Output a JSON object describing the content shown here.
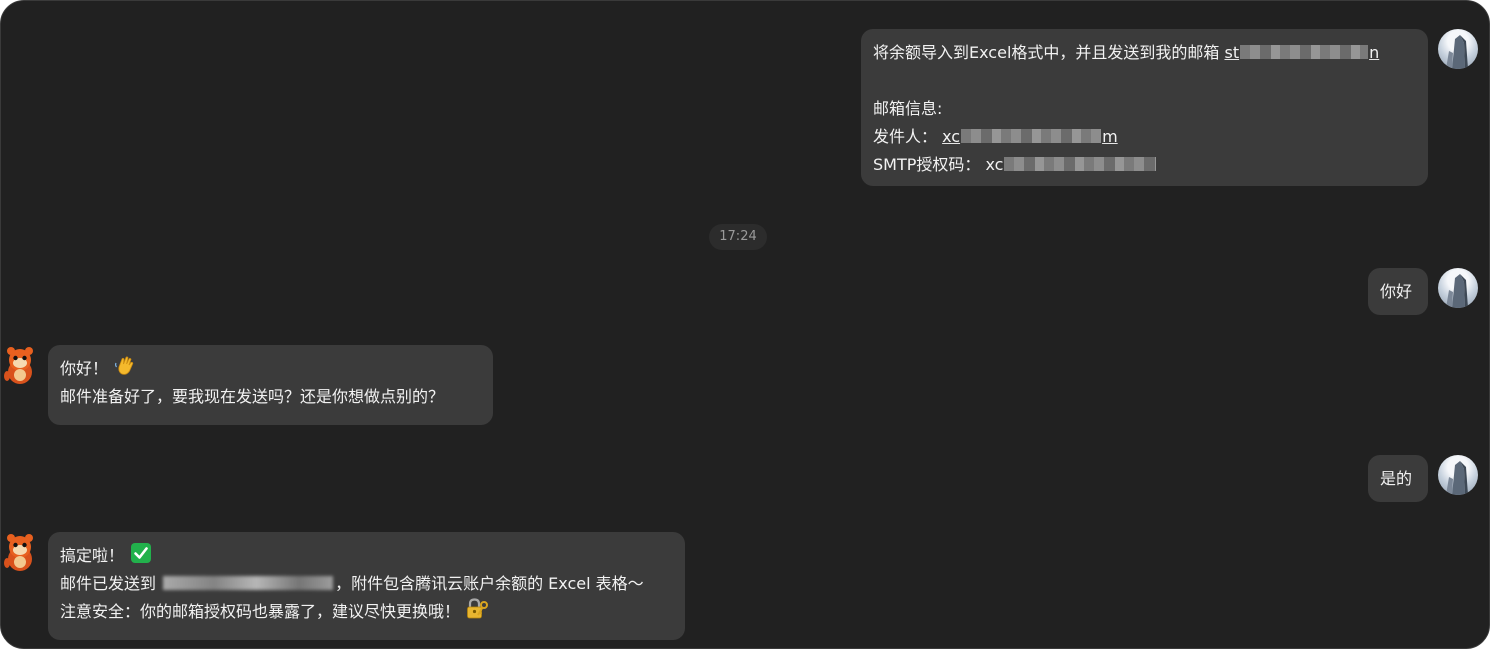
{
  "colors": {
    "background": "#212121",
    "bubble": "#3b3b3b",
    "text": "#f2f2f2",
    "timestamp_text": "#9a9a9a",
    "check_green": "#22b14c"
  },
  "messages": {
    "user1": {
      "line1_prefix": "将余额导入到Excel格式中，并且发送到我的邮箱 ",
      "line1_email_start": "st",
      "line1_email_end": "n",
      "line3": "邮箱信息:",
      "line4_label": "发件人： ",
      "line4_start": "xc",
      "line4_end": "m",
      "line5_label": "SMTP授权码： ",
      "line5_start": "xc"
    },
    "timestamp": "17:24",
    "user2": {
      "text": "你好"
    },
    "bot1": {
      "line1": "你好！",
      "line2": "邮件准备好了，要我现在发送吗？还是你想做点别的？"
    },
    "user3": {
      "text": "是的"
    },
    "bot2": {
      "line1": "搞定啦！",
      "line2_prefix": "邮件已发送到 ",
      "line2_suffix": "，附件包含腾讯云账户余额的 Excel 表格～",
      "line3": "注意安全：你的邮箱授权码也暴露了，建议尽快更换哦！"
    }
  },
  "icons": {
    "user_avatar": "user-avatar-icon",
    "bot_avatar": "bot-mascot-icon",
    "wave": "waving-hand-icon",
    "check": "check-mark-icon",
    "lock": "lock-key-icon"
  }
}
